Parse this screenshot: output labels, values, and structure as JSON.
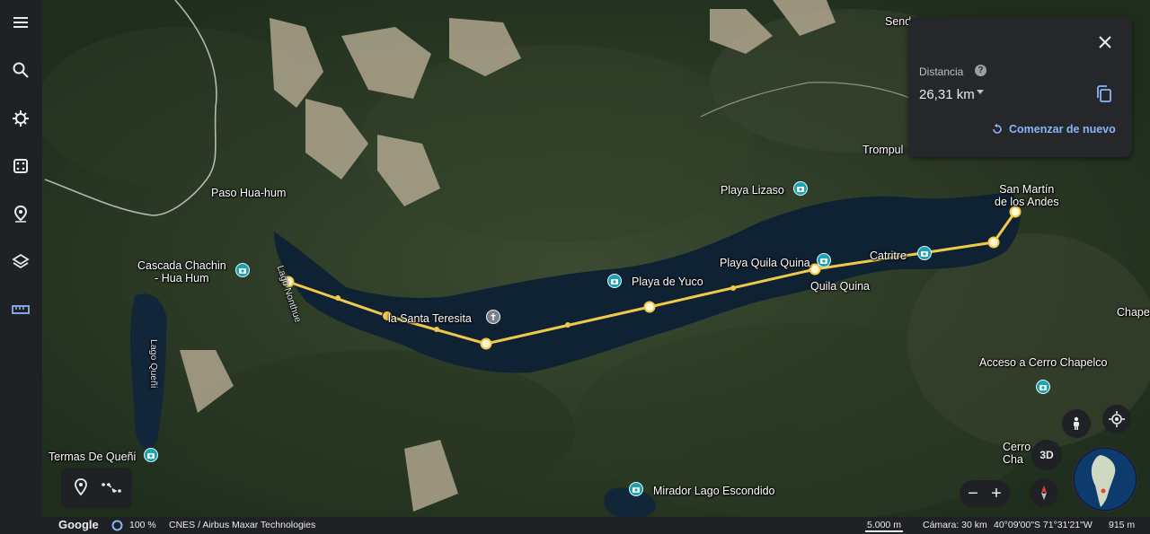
{
  "rail": {
    "items": [
      {
        "name": "menu-icon"
      },
      {
        "name": "search-icon"
      },
      {
        "name": "voyager-icon"
      },
      {
        "name": "feeling-lucky-icon"
      },
      {
        "name": "projects-icon"
      },
      {
        "name": "map-style-icon"
      },
      {
        "name": "measure-icon"
      }
    ]
  },
  "labels": {
    "paso": "Paso Hua-hum",
    "cascada": "Cascada Chachin\n- Hua Hum",
    "lago_nonthue": "Lago Nonthue",
    "lago_queni": "Lago Queñi",
    "santa_teresita": "la Santa Teresita",
    "playa_yuco": "Playa de Yuco",
    "playa_lizaso": "Playa Lizaso",
    "playa_quila": "Playa Quila Quina",
    "quila_quina": "Quila Quina",
    "catritre": "Catritre",
    "san_martin": "San Martín\nde los Andes",
    "trompul": "Trompul",
    "sendero": "Send",
    "chape": "Chape",
    "acceso_chapelco": "Acceso a Cerro Chapelco",
    "cerro_cha": "Cerro\nCha",
    "termas": "Termas De Queñi",
    "mirador": "Mirador Lago Escondido"
  },
  "measure": {
    "label": "Distancia",
    "help": "?",
    "value": "26,31 km",
    "restart": "Comenzar de nuevo"
  },
  "controls": {
    "view3d": "3D",
    "zoom_out": "−",
    "zoom_in": "+"
  },
  "status": {
    "logo": "Google",
    "zoom": "100 %",
    "attribution": "CNES / Airbus  Maxar Technologies",
    "scale": "5.000 m",
    "camera": "Cámara: 30 km",
    "coords": "40°09'00\"S 71°31'21\"W",
    "elevation": "915 m"
  },
  "colors": {
    "route": "#f0c94a",
    "lake": "#0f2233",
    "poi": "#1aa3b5",
    "link": "#8ab4f8"
  }
}
